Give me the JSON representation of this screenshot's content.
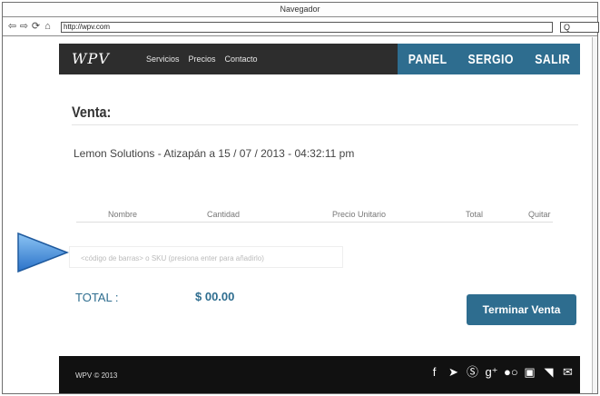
{
  "window": {
    "title": "Navegador"
  },
  "browser": {
    "url": "http://wpv.com",
    "search_glyph": "Q"
  },
  "navbar": {
    "logo": "WPV",
    "menu": [
      "Servicios",
      "Precios",
      "Contacto"
    ],
    "user_links": [
      "PANEL",
      "SERGIO",
      "SALIR"
    ]
  },
  "sale": {
    "heading": "Venta:",
    "info": "Lemon Solutions - Atizapán a 15 / 07 / 2013 - 04:32:11 pm",
    "columns": [
      "Nombre",
      "Cantidad",
      "Precio Unitario",
      "Total",
      "Quitar"
    ],
    "barcode_placeholder": "<código de barras> o SKU (presiona enter para añadirlo)",
    "total_label": "TOTAL :",
    "total_value": "$ 00.00",
    "finish_button": "Terminar Venta"
  },
  "footer": {
    "copyright": "WPV © 2013",
    "social_icons": [
      "facebook-icon",
      "twitter-icon",
      "skype-icon",
      "google-plus-icon",
      "flickr-icon",
      "youtube-icon",
      "rss-icon",
      "email-icon"
    ]
  },
  "colors": {
    "accent": "#2e6d8f",
    "navbar": "#2d2d2d",
    "footer": "#111111",
    "pointer": "#3d8fe0"
  }
}
